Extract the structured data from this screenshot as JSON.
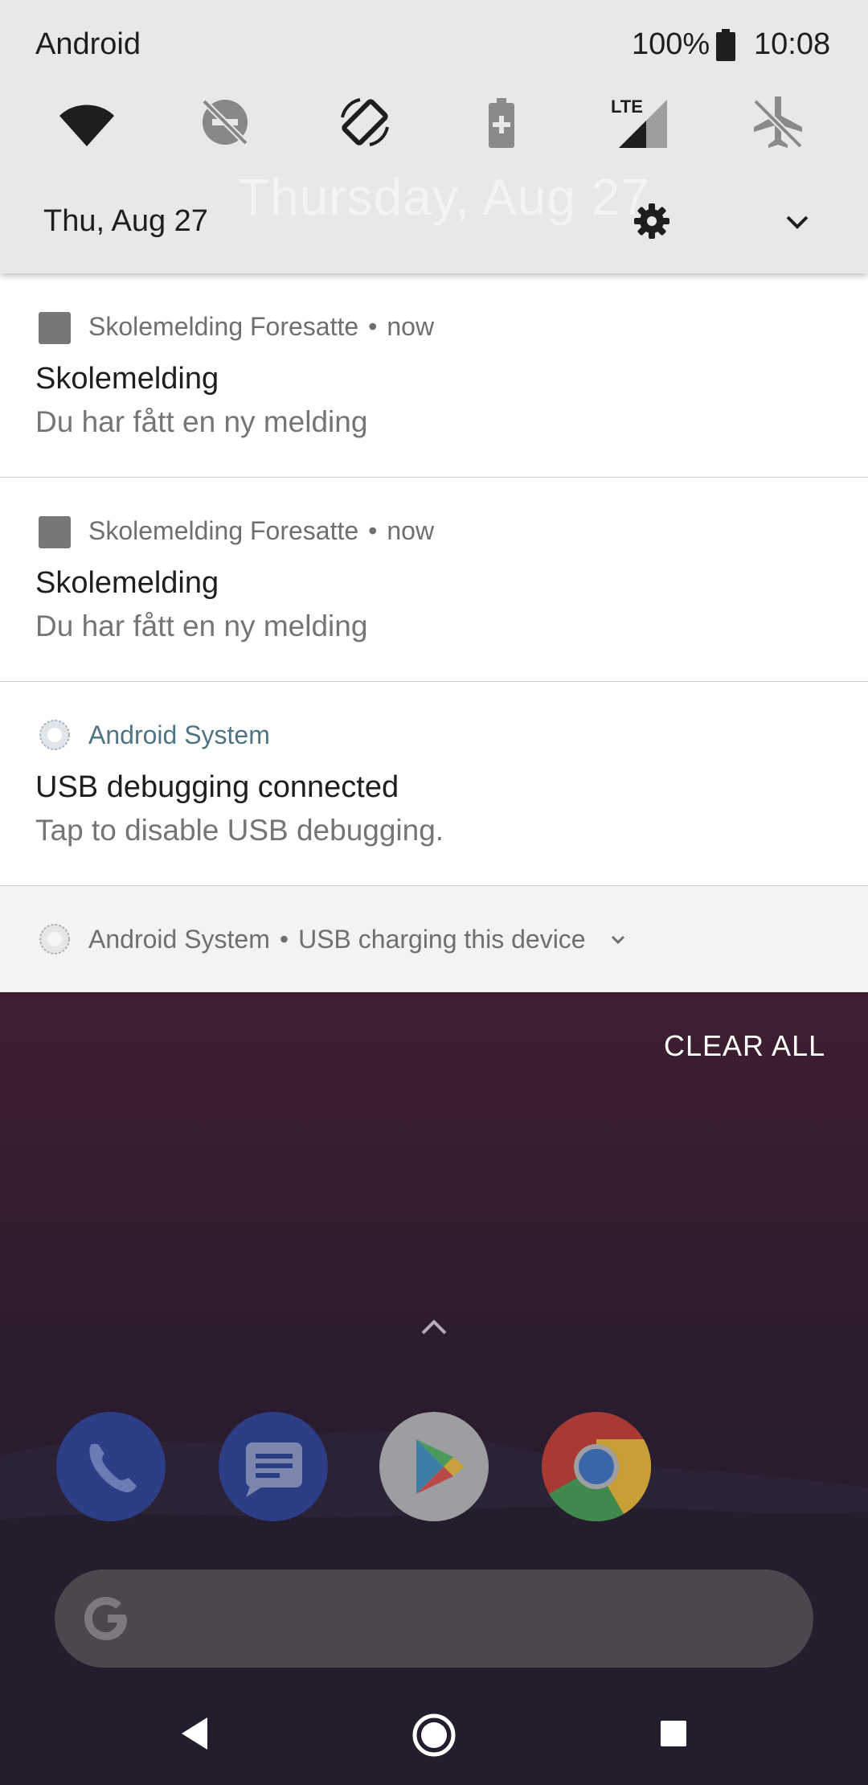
{
  "status_bar": {
    "carrier": "Android",
    "battery_percent": "100%",
    "time": "10:08"
  },
  "quick_settings": {
    "tiles": [
      {
        "name": "wifi",
        "state": "on"
      },
      {
        "name": "do-not-disturb",
        "state": "off"
      },
      {
        "name": "auto-rotate",
        "state": "on"
      },
      {
        "name": "battery-saver",
        "state": "off"
      },
      {
        "name": "mobile-data",
        "label": "LTE",
        "state": "on"
      },
      {
        "name": "airplane-mode",
        "state": "off"
      }
    ],
    "date": "Thu, Aug 27",
    "ghost_date": "Thursday, Aug 27"
  },
  "notifications": [
    {
      "app": "Skolemelding Foresatte",
      "time": "now",
      "title": "Skolemelding",
      "body": "Du har fått en ny melding"
    },
    {
      "app": "Skolemelding Foresatte",
      "time": "now",
      "title": "Skolemelding",
      "body": "Du har fått en ny melding"
    },
    {
      "app": "Android System",
      "title": "USB debugging connected",
      "body": "Tap to disable USB debugging."
    }
  ],
  "collapsed_notification": {
    "app": "Android System",
    "text": "USB charging this device"
  },
  "clear_all_label": "CLEAR ALL",
  "dock": {
    "apps": [
      "phone",
      "messages",
      "play-store",
      "chrome"
    ]
  },
  "colors": {
    "shade_bg": "#e8e7e9",
    "accent_system": "#4f7483",
    "search_bar": "#4c464f"
  }
}
